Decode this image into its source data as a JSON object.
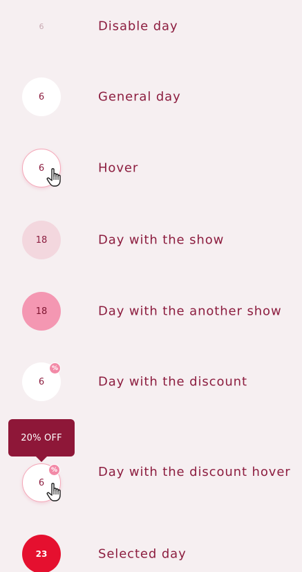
{
  "states": [
    {
      "key": "disabled",
      "day": "6",
      "label": "Disable day"
    },
    {
      "key": "general",
      "day": "6",
      "label": "General day"
    },
    {
      "key": "hover",
      "day": "6",
      "label": "Hover"
    },
    {
      "key": "show",
      "day": "18",
      "label": "Day with the show"
    },
    {
      "key": "another",
      "day": "18",
      "label": "Day with the another show"
    },
    {
      "key": "discount",
      "day": "6",
      "label": "Day with the discount",
      "badge": "%"
    },
    {
      "key": "discount_hover",
      "day": "6",
      "label": "Day with the discount hover",
      "badge": "%"
    },
    {
      "key": "selected",
      "day": "23",
      "label": "Selected day"
    }
  ],
  "tooltip": {
    "text": "20% OFF"
  },
  "icons": {
    "cursor": "hand-pointer-icon",
    "discount": "percent-badge-icon"
  },
  "colors": {
    "background": "#f6eff1",
    "label": "#8c1d3f",
    "show": "#f3d7de",
    "another_show": "#f497b2",
    "discount_badge": "#f28aa7",
    "selected": "#e5102f",
    "tooltip": "#8e1738"
  }
}
